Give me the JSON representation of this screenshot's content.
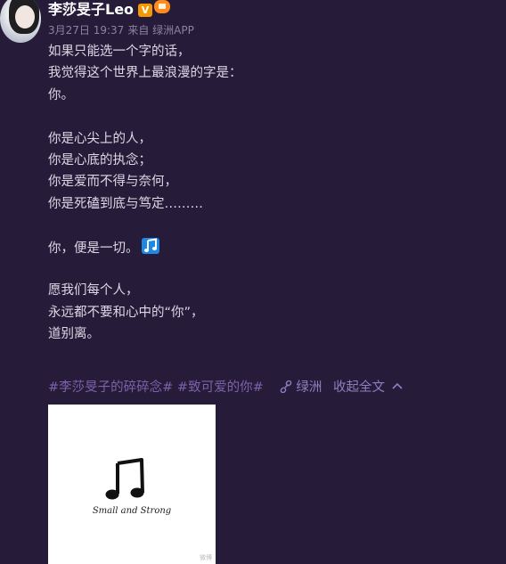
{
  "user": {
    "name": "李莎旻子Leo",
    "v_badge": "V"
  },
  "meta": {
    "date": "3月27日 19:37",
    "source": "来自 绿洲APP"
  },
  "post": {
    "lines": [
      "如果只能选一个字的话，",
      "我觉得这个世界上最浪漫的字是：",
      "你。",
      "",
      "你是心尖上的人，",
      "你是心底的执念；",
      "你是爱而不得与奈何，",
      "你是死磕到底与笃定………",
      "",
      "你，便是一切。",
      "",
      "愿我们每个人，",
      "永远都不要和心中的“你”，",
      "道别离。"
    ],
    "emoji_icon": "music-note-icon"
  },
  "footer": {
    "tag1": "#李莎旻子的碎碎念#",
    "tag2": "#致可爱的你#",
    "location": "绿洲",
    "collapse": "收起全文"
  },
  "image": {
    "caption": "Small and Strong",
    "watermark": "微博"
  },
  "colors": {
    "background": "#261c3a",
    "tag": "#7c62a8",
    "link": "#8f7fbf",
    "text": "#dcd8e5"
  }
}
